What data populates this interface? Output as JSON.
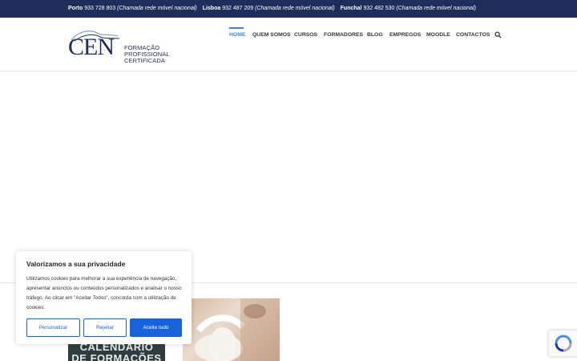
{
  "topbar": {
    "porto_label": "Porto",
    "porto_phone": "933 728 803",
    "porto_note": "(Chamada rede móvel nacional)",
    "lisboa_label": "Lisboa",
    "lisboa_phone": "932 487 209",
    "lisboa_note": "(Chamada rede móvel nacional)",
    "funchal_label": "Funchal",
    "funchal_phone": "932 482 530",
    "funchal_note": "(Chamada rede móvel nacional)"
  },
  "logo": {
    "mark": "CEN",
    "line1": "FORMAÇÃO PROFISSIONAL",
    "line2": "CERTIFICADA"
  },
  "nav": {
    "items": [
      {
        "label": "HOME",
        "active": true
      },
      {
        "label": "QUEM SOMOS"
      },
      {
        "label": "CURSOS"
      },
      {
        "label": "FORMADORES"
      },
      {
        "label": "BLOG"
      },
      {
        "label": "EMPREGOS"
      },
      {
        "label": "MOODLE"
      },
      {
        "label": "CONTACTOS"
      }
    ],
    "search_icon": "search-icon"
  },
  "promo": {
    "line1": "CALENDÁRIO",
    "line2": "DE FORMAÇÕES"
  },
  "cookie": {
    "title": "Valorizamos a sua privacidade",
    "text": "Utilizamos cookies para melhorar a sua experiência de navegação, apresentar anúncios ou conteúdos personalizados e analisar o nosso tráfego. Ao clicar em \"Aceitar Todos\", concorda com a utilização de cookies.",
    "customize": "Personalizar",
    "reject": "Rejeitar",
    "accept": "Aceite tudo"
  },
  "colors": {
    "topbar_bg": "#1f2d5c",
    "accent": "#3e8ad2",
    "cookie_button": "#1863dc"
  }
}
